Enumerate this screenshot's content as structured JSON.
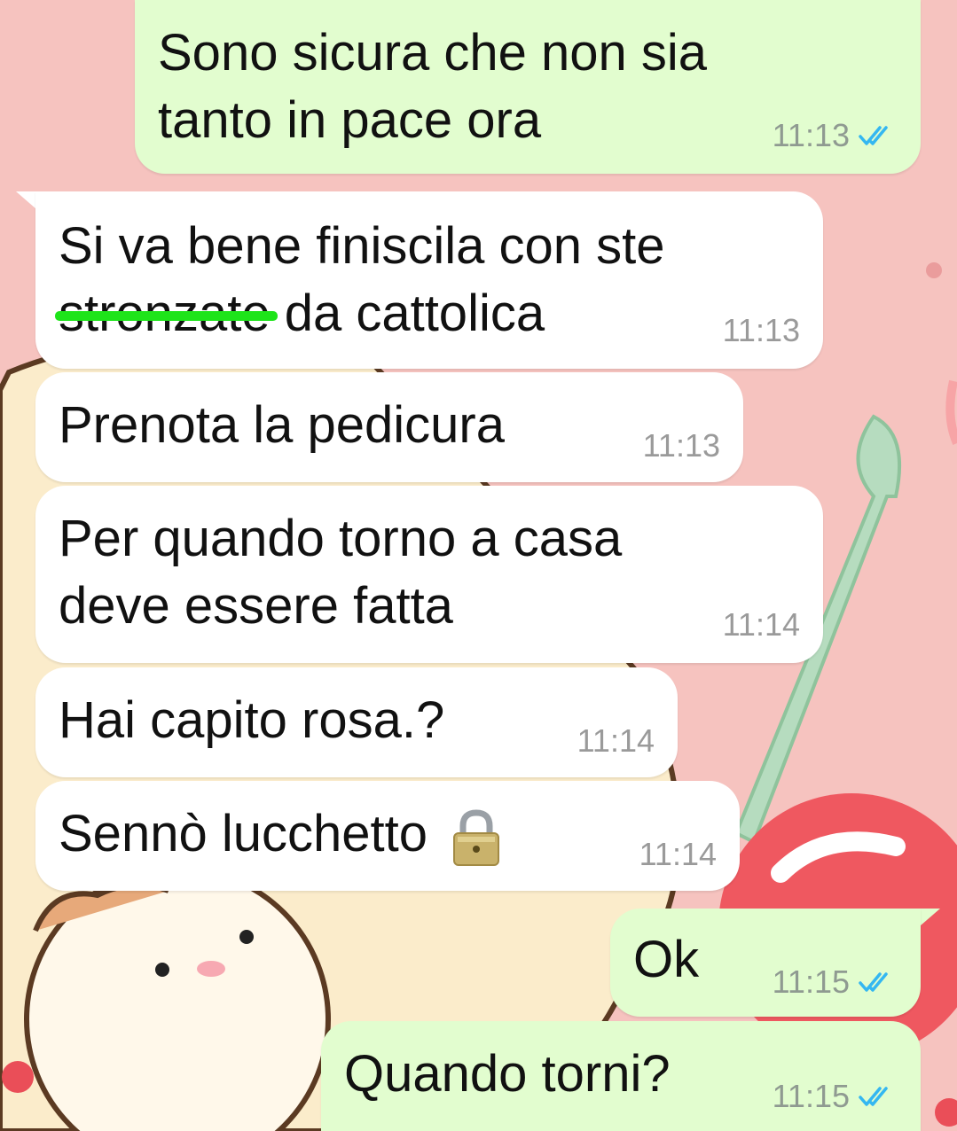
{
  "colors": {
    "incoming_bubble": "#ffffff",
    "outgoing_bubble": "#e2fdcf",
    "read_ticks": "#34b7f1",
    "strike_highlight": "#1ee41a",
    "wallpaper": "#f6c3bf"
  },
  "messages": [
    {
      "direction": "outgoing",
      "lines": [
        "Sono sicura che non sia",
        "tanto in pace ora"
      ],
      "time": "11:13",
      "status_icon": "double-check-read-icon"
    },
    {
      "direction": "incoming",
      "lines": [
        "Si va bene finiscila con ste"
      ],
      "line2": {
        "struck": "stronzate",
        "rest": " da cattolica"
      },
      "time": "11:13"
    },
    {
      "direction": "incoming",
      "lines": [
        "Prenota la pedicura"
      ],
      "time": "11:13"
    },
    {
      "direction": "incoming",
      "lines": [
        "Per quando torno a casa",
        "deve essere fatta"
      ],
      "time": "11:14"
    },
    {
      "direction": "incoming",
      "lines": [
        "Hai capito rosa.?"
      ],
      "time": "11:14"
    },
    {
      "direction": "incoming",
      "text": "Sennò lucchetto",
      "emoji": "lock-icon",
      "time": "11:14"
    },
    {
      "direction": "outgoing",
      "lines": [
        "Ok"
      ],
      "time": "11:15",
      "status_icon": "double-check-read-icon"
    },
    {
      "direction": "outgoing",
      "lines": [
        "Quando torni?"
      ],
      "time": "11:15",
      "status_icon": "double-check-read-icon"
    }
  ]
}
